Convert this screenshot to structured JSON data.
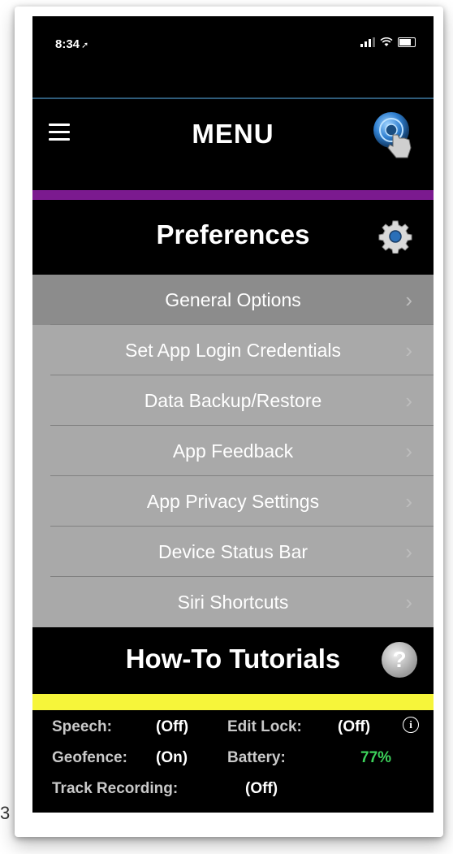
{
  "status_bar": {
    "time": "8:34",
    "location_glyph": "➚"
  },
  "header": {
    "title": "MENU"
  },
  "preferences": {
    "title": "Preferences"
  },
  "menu_items": [
    {
      "label": "General Options"
    },
    {
      "label": "Set App Login Credentials"
    },
    {
      "label": "Data Backup/Restore"
    },
    {
      "label": "App Feedback"
    },
    {
      "label": "App Privacy Settings"
    },
    {
      "label": "Device Status Bar"
    },
    {
      "label": "Siri Shortcuts"
    }
  ],
  "chevron": "›",
  "howto": {
    "title": "How-To Tutorials",
    "icon_glyph": "?"
  },
  "footer": {
    "speech_label": "Speech:",
    "speech_value": "(Off)",
    "edit_lock_label": "Edit Lock:",
    "edit_lock_value": "(Off)",
    "geofence_label": "Geofence:",
    "geofence_value": "(On)",
    "battery_label": "Battery:",
    "battery_value": "77%",
    "track_label": "Track Recording:",
    "track_value": "(Off)",
    "info_glyph": "i"
  },
  "stray_char": "3",
  "colors": {
    "accent_purple": "#7b1a8f",
    "accent_yellow": "#f6f53a",
    "battery_green": "#3cd15a",
    "header_border": "#2f5c7a"
  },
  "icons": [
    "hamburger-icon",
    "touch-help-icon",
    "gear-icon",
    "help-icon",
    "info-icon"
  ]
}
